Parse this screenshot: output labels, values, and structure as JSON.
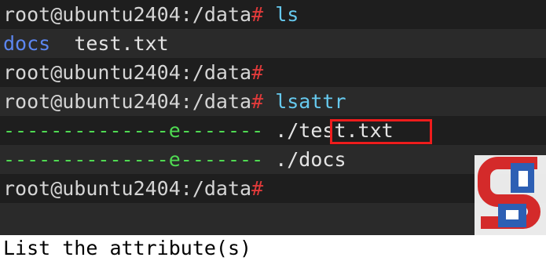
{
  "terminal": {
    "lines": [
      {
        "prompt": "root@ubuntu2404:/data",
        "hash": "#",
        "command": "ls"
      },
      {
        "dir": "docs",
        "file": "test.txt"
      },
      {
        "prompt": "root@ubuntu2404:/data",
        "hash": "#"
      },
      {
        "prompt": "root@ubuntu2404:/data",
        "hash": "#",
        "command": "lsattr"
      },
      {
        "attrs": "--------------e-------",
        "path": "./test.txt"
      },
      {
        "attrs": "--------------e-------",
        "path": "./docs"
      },
      {
        "prompt": "root@ubuntu2404:/data",
        "hash": "#"
      }
    ]
  },
  "logo": {
    "icon": "sb-logo-watermark",
    "colors": {
      "red": "#d42a2a",
      "blue": "#2d5fb4"
    }
  },
  "caption": "List the attribute(s)",
  "colors": {
    "background": "#1e1e1e",
    "prompt": "#d5d5d5",
    "hash": "#e03a3a",
    "command": "#66c9ee",
    "directory": "#5c86f0",
    "attribute_dashes": "#4fda52",
    "highlight_box": "#ee1c1c"
  }
}
